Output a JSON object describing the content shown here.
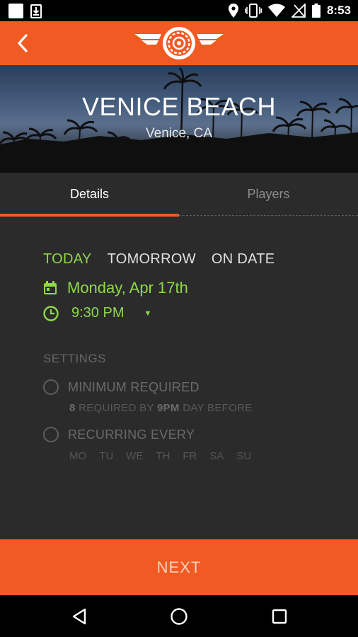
{
  "status_bar": {
    "time": "8:53",
    "icons": [
      "notification-square-icon",
      "download-icon",
      "location-icon",
      "vibrate-icon",
      "wifi-icon",
      "no-signal-icon",
      "battery-icon"
    ]
  },
  "app_bar": {
    "back_icon": "chevron-left-icon",
    "logo": "wheel-wings-logo"
  },
  "hero": {
    "title": "VENICE BEACH",
    "subtitle": "Venice, CA"
  },
  "tabs": [
    {
      "label": "Details",
      "selected": true
    },
    {
      "label": "Players",
      "selected": false
    }
  ],
  "schedule": {
    "day_options": [
      "TODAY",
      "TOMORROW",
      "ON DATE"
    ],
    "selected_day": "TODAY",
    "date": "Monday, Apr 17th",
    "time": "9:30 PM"
  },
  "settings": {
    "label": "SETTINGS",
    "minimum": {
      "label": "MINIMUM REQUIRED",
      "count": "8",
      "req_text": " REQUIRED BY ",
      "time": "9PM",
      "suffix": " DAY BEFORE"
    },
    "recurring": {
      "label": "RECURRING EVERY",
      "days": [
        "MO",
        "TU",
        "WE",
        "TH",
        "FR",
        "SA",
        "SU"
      ]
    }
  },
  "footer": {
    "next_label": "NEXT"
  },
  "colors": {
    "accent": "#f15a22",
    "green": "#8ed84a",
    "background": "#2b2b2b"
  }
}
